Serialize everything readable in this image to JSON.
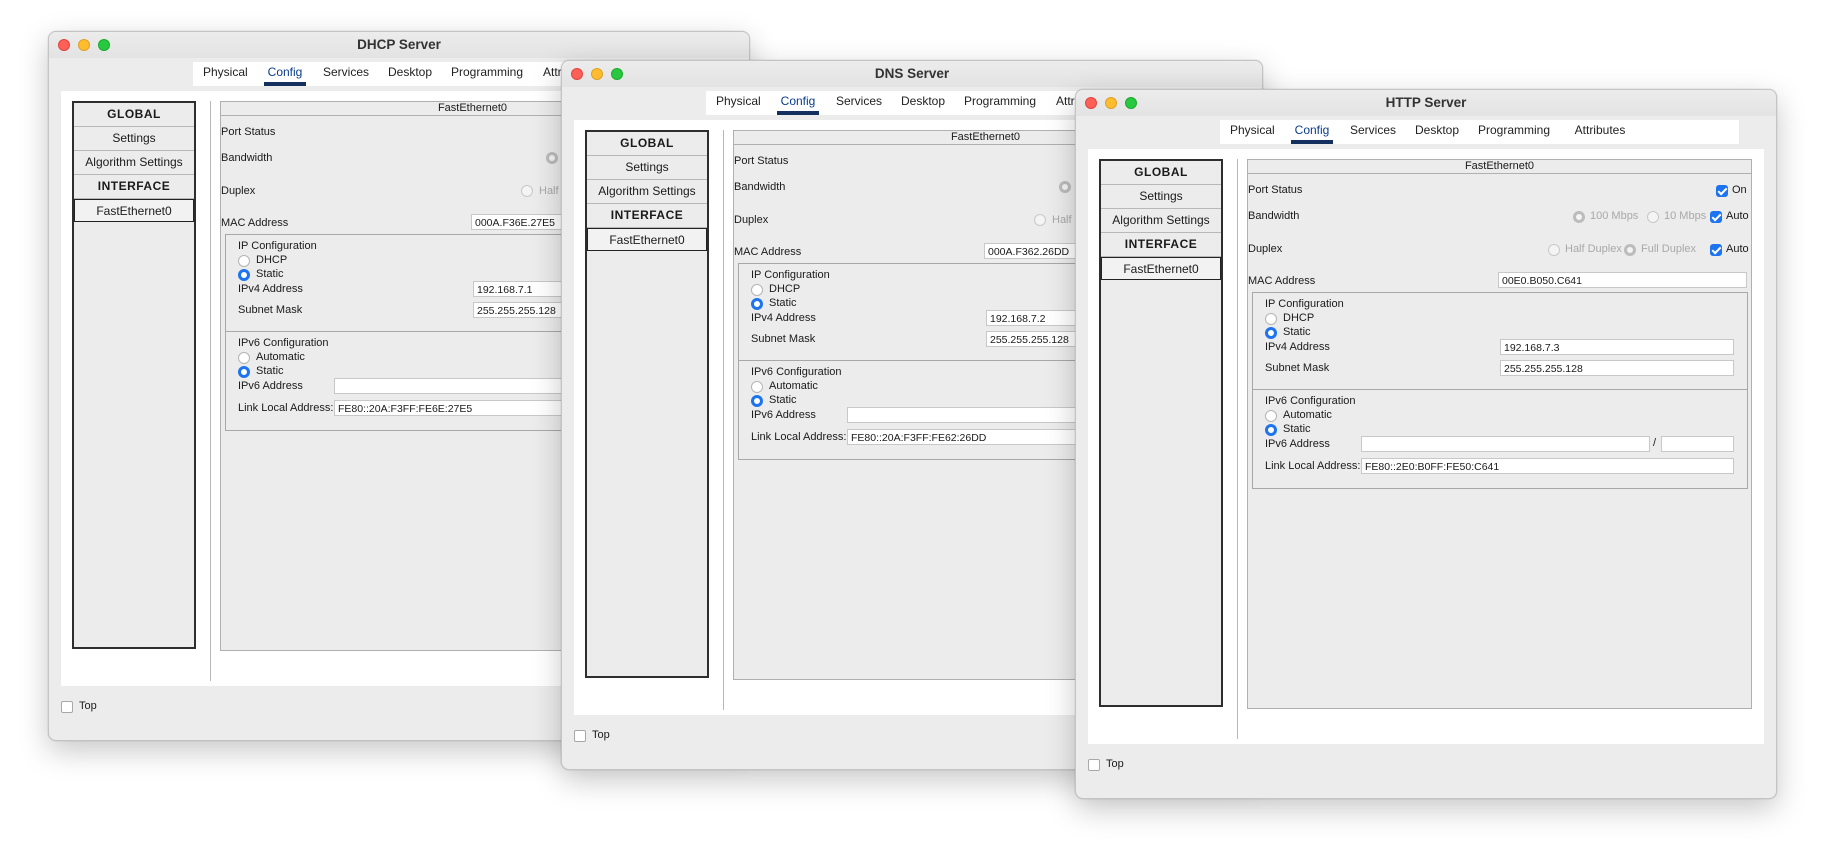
{
  "tabs": [
    "Physical",
    "Config",
    "Services",
    "Desktop",
    "Programming",
    "Attributes"
  ],
  "sidebar": {
    "global": "GLOBAL",
    "settings": "Settings",
    "algorithm": "Algorithm Settings",
    "interface": "INTERFACE",
    "fastethernet": "FastEthernet0"
  },
  "labels": {
    "panel_title": "FastEthernet0",
    "port_status": "Port Status",
    "on": "On",
    "bandwidth": "Bandwidth",
    "mbps100": "100 Mbps",
    "mbps10": "10 Mbps",
    "auto": "Auto",
    "duplex": "Duplex",
    "half_duplex": "Half Duplex",
    "full_duplex": "Full Duplex",
    "half": "Half",
    "mac_address": "MAC Address",
    "ip_config": "IP Configuration",
    "dhcp": "DHCP",
    "static": "Static",
    "ipv4": "IPv4 Address",
    "subnet": "Subnet Mask",
    "ipv6_config": "IPv6 Configuration",
    "automatic": "Automatic",
    "ipv6": "IPv6 Address",
    "link_local": "Link Local Address:",
    "slash": "/",
    "top": "Top"
  },
  "windows": {
    "dhcp": {
      "title": "DHCP Server",
      "mac": "000A.F36E.27E5",
      "ipv4": "192.168.7.1",
      "mask": "255.255.255.128",
      "link_local": "FE80::20A:F3FF:FE6E:27E5"
    },
    "dns": {
      "title": "DNS Server",
      "mac": "000A.F362.26DD",
      "ipv4": "192.168.7.2",
      "mask": "255.255.255.128",
      "link_local": "FE80::20A:F3FF:FE62:26DD"
    },
    "http": {
      "title": "HTTP Server",
      "mac": "00E0.B050.C641",
      "ipv4": "192.168.7.3",
      "mask": "255.255.255.128",
      "link_local": "FE80::2E0:B0FF:FE50:C641"
    }
  },
  "colors": {
    "accent": "#1e73f0",
    "tab_underline": "#13305e",
    "close": "#fe5f57",
    "minimize": "#febc2e",
    "maximize": "#28c840"
  }
}
